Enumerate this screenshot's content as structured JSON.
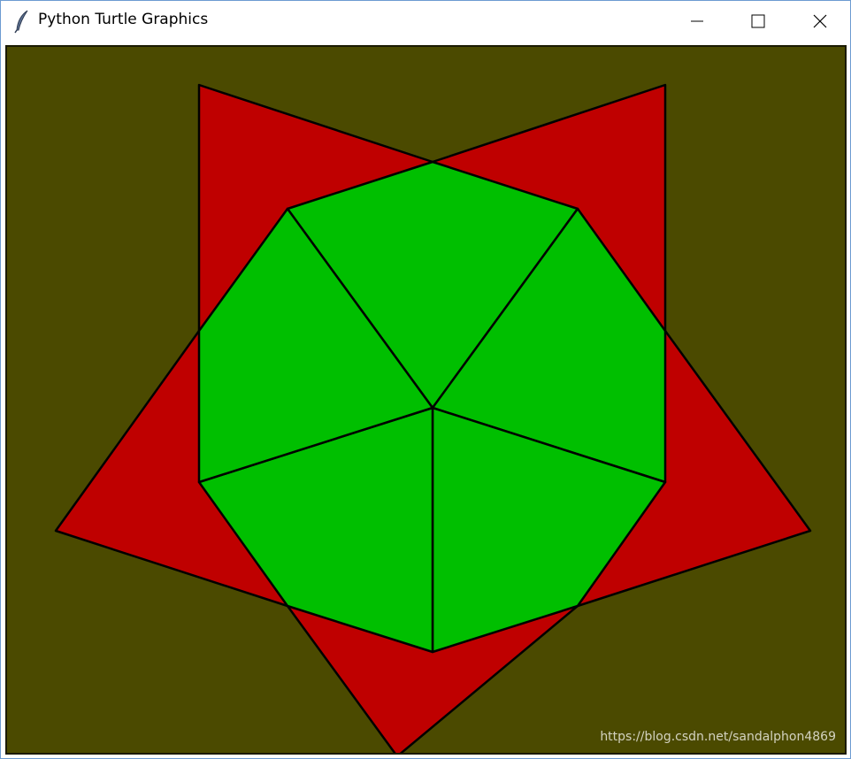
{
  "window": {
    "title": "Python Turtle Graphics",
    "icon": "feather-icon",
    "controls": [
      "minimize-icon",
      "maximize-icon",
      "close-icon"
    ]
  },
  "canvas": {
    "background_color": "#4b4a00",
    "star_color": "#bf0000",
    "polygon_color": "#00bf00",
    "stroke_color": "#000000"
  },
  "watermark": "https://blog.csdn.net/sandalphon4869"
}
